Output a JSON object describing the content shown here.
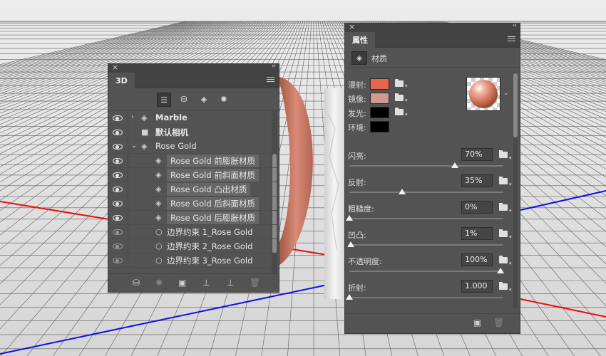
{
  "panel3d": {
    "tab": "3D",
    "layers": [
      {
        "label": "Marble",
        "arrow": "›",
        "icon": "cube-icon",
        "visible": true,
        "selected": false,
        "bold": true
      },
      {
        "label": "默认相机",
        "arrow": "",
        "icon": "camera-icon",
        "visible": true,
        "selected": false,
        "bold": true
      },
      {
        "label": "Rose Gold",
        "arrow": "⌄",
        "icon": "cube-icon",
        "visible": true,
        "selected": false,
        "bold": false
      },
      {
        "label": "Rose Gold 前膨胀材质",
        "arrow": "",
        "icon": "material-icon",
        "visible": true,
        "selected": true,
        "bold": false
      },
      {
        "label": "Rose Gold 前斜面材质",
        "arrow": "",
        "icon": "material-icon",
        "visible": true,
        "selected": true,
        "bold": false
      },
      {
        "label": "Rose Gold 凸出材质",
        "arrow": "",
        "icon": "material-icon",
        "visible": true,
        "selected": true,
        "bold": false
      },
      {
        "label": "Rose Gold 后斜面材质",
        "arrow": "",
        "icon": "material-icon",
        "visible": true,
        "selected": true,
        "bold": false
      },
      {
        "label": "Rose Gold 后膨胀材质",
        "arrow": "",
        "icon": "material-icon",
        "visible": true,
        "selected": true,
        "bold": false
      },
      {
        "label": "边界约束 1_Rose Gold",
        "arrow": "",
        "icon": "constraint-icon",
        "visible": false,
        "selected": false,
        "bold": false
      },
      {
        "label": "边界约束 2_Rose Gold",
        "arrow": "",
        "icon": "constraint-icon",
        "visible": false,
        "selected": false,
        "bold": false
      },
      {
        "label": "边界约束 3_Rose Gold",
        "arrow": "",
        "icon": "constraint-icon",
        "visible": false,
        "selected": false,
        "bold": false
      }
    ]
  },
  "props": {
    "tab": "属性",
    "section_label": "材质",
    "swatches": [
      {
        "label": "漫射:",
        "color": "#e5664b",
        "has_folder": true
      },
      {
        "label": "镜像:",
        "color": "#d29a8c",
        "has_folder": true
      },
      {
        "label": "发光:",
        "color": "#000000",
        "has_folder": true
      },
      {
        "label": "环境:",
        "color": "#000000",
        "has_folder": false
      }
    ],
    "sliders": [
      {
        "label": "闪亮:",
        "value": "70%",
        "level": 0.7
      },
      {
        "label": "反射:",
        "value": "35%",
        "level": 0.35
      },
      {
        "label": "粗糙度:",
        "value": "0%",
        "level": 0.0
      },
      {
        "label": "凹凸:",
        "value": "1%",
        "level": 0.01
      },
      {
        "label": "不透明度:",
        "value": "100%",
        "level": 1.0
      },
      {
        "label": "折射:",
        "value": "1.000",
        "level": 0.0
      }
    ]
  }
}
